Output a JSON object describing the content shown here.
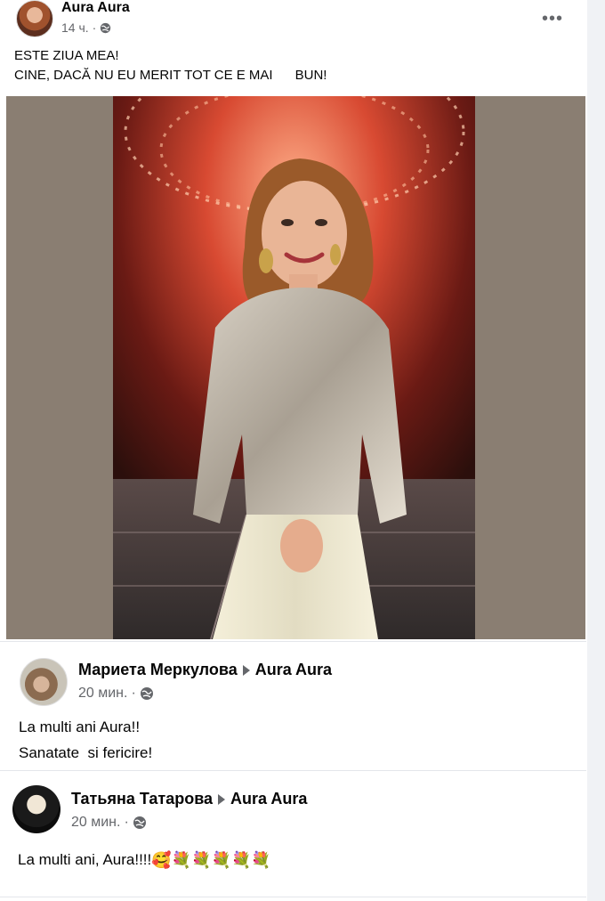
{
  "post": {
    "author": "Aura Aura",
    "time": "14 ч.",
    "line1": "ESTE ZIUA MEA!",
    "line2": "CINE, DACĂ NU EU MERIT TOT CE E MAI      BUN!"
  },
  "comments": [
    {
      "author": "Мариета Меркулова",
      "target": "Aura Aura",
      "time": "20 мин.",
      "line1": "La multi ani Aura!!",
      "line2": "Sanatate  si fericire!"
    },
    {
      "author": "Татьяна Татарова",
      "target": "Aura Aura",
      "time": "20 мин.",
      "line1": "La multi ani, Aura!!!!",
      "emojis": [
        "🥰",
        "💐",
        "💐",
        "💐",
        "💐",
        "💐"
      ]
    }
  ],
  "icons": {
    "globe": "globe-icon",
    "more": "more-options-icon",
    "arrow": "arrow-right-icon"
  },
  "colors": {
    "meta_text": "#65676b",
    "photo_background": "#8a7e72",
    "stage_red": "#c0392b"
  }
}
